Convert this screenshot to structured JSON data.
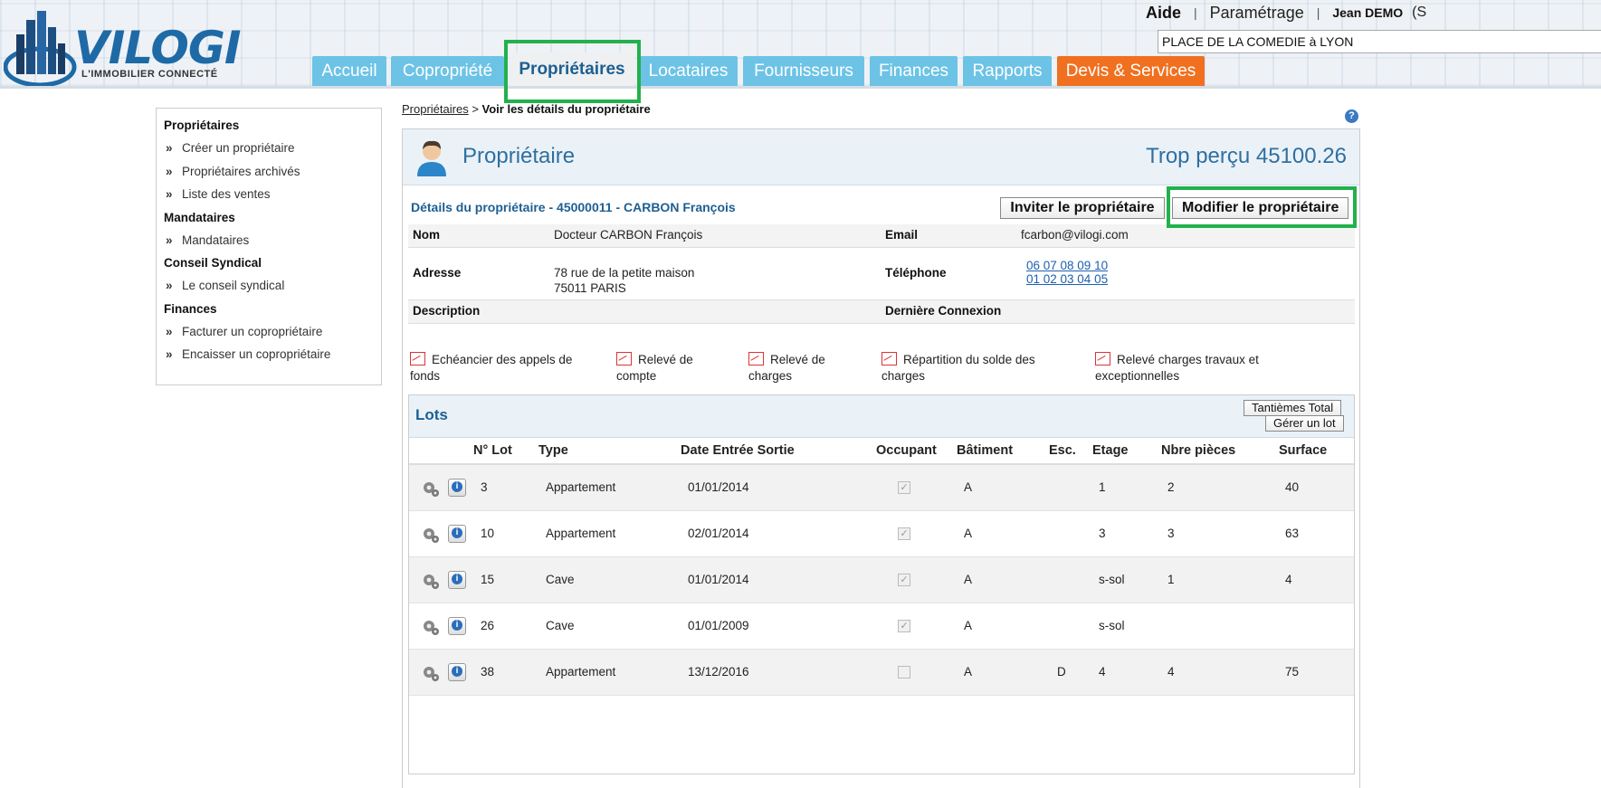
{
  "app": {
    "brand": "VILOGI",
    "tagline": "L'IMMOBILIER CONNECTÉ",
    "accent": "#1e6aa6",
    "tab_color": "#6cc3e6",
    "tab_orange": "#f07020"
  },
  "top": {
    "help": "Aide",
    "separator": "|",
    "settings": "Paramétrage",
    "user": "Jean DEMO",
    "user_extra": "(S",
    "search_value": "PLACE DE LA COMEDIE à LYON"
  },
  "nav": {
    "tabs": [
      {
        "label": "Accueil"
      },
      {
        "label": "Copropriété"
      },
      {
        "label": "Propriétaires",
        "active": true
      },
      {
        "label": "Locataires"
      },
      {
        "label": "Fournisseurs"
      },
      {
        "label": "Finances"
      },
      {
        "label": "Rapports"
      },
      {
        "label": "Devis & Services"
      }
    ]
  },
  "sidebar": {
    "sections": [
      {
        "title": "Propriétaires",
        "items": [
          "Créer un propriétaire",
          "Propriétaires archivés",
          "Liste des ventes"
        ]
      },
      {
        "title": "Mandataires",
        "items": [
          "Mandataires"
        ]
      },
      {
        "title": "Conseil Syndical",
        "items": [
          "Le conseil syndical"
        ]
      },
      {
        "title": "Finances",
        "items": [
          "Facturer un copropriétaire",
          "Encaisser un copropriétaire"
        ]
      }
    ]
  },
  "breadcrumb": {
    "link": "Propriétaires",
    "sep": " > ",
    "current": "Voir les détails du propriétaire"
  },
  "panel": {
    "title": "Propriétaire",
    "trop_percu": "Trop perçu 45100.26",
    "details_title": "Détails du propriétaire - 45000011 - CARBON François",
    "invite_button": "Inviter le propriétaire",
    "edit_button": "Modifier le propriétaire",
    "fields": {
      "nom_label": "Nom",
      "nom_value": "Docteur CARBON François",
      "email_label": "Email",
      "email_value": "fcarbon@vilogi.com",
      "adresse_label": "Adresse",
      "adresse_line1": "78 rue de la petite maison",
      "adresse_line2": "75011 PARIS",
      "tel_label": "Téléphone",
      "tel_1": "06 07 08 09 10",
      "tel_2": "01 02 03 04 05",
      "description_label": "Description",
      "connexion_label": "Dernière Connexion"
    },
    "documents": [
      {
        "line1": "Echéancier des appels de",
        "line2": "fonds"
      },
      {
        "line1": "Relevé de",
        "line2": "compte"
      },
      {
        "line1": "Relevé de",
        "line2": "charges"
      },
      {
        "line1": "Répartition du solde des",
        "line2": "charges"
      },
      {
        "line1": "Relevé charges travaux et",
        "line2": "exceptionnelles"
      }
    ]
  },
  "lots": {
    "title": "Lots",
    "tantiemes_button": "Tantièmes Total",
    "manage_button": "Gérer un lot",
    "columns": [
      "N° Lot",
      "Type",
      "Date Entrée Sortie",
      "Occupant",
      "Bâtiment",
      "Esc.",
      "Etage",
      "Nbre pièces",
      "Surface"
    ],
    "rows": [
      {
        "lot": "3",
        "type": "Appartement",
        "date": "01/01/2014",
        "occupant": true,
        "batiment": "A",
        "esc": "",
        "etage": "1",
        "pieces": "2",
        "surface": "40"
      },
      {
        "lot": "10",
        "type": "Appartement",
        "date": "02/01/2014",
        "occupant": true,
        "batiment": "A",
        "esc": "",
        "etage": "3",
        "pieces": "3",
        "surface": "63"
      },
      {
        "lot": "15",
        "type": "Cave",
        "date": "01/01/2014",
        "occupant": true,
        "batiment": "A",
        "esc": "",
        "etage": "s-sol",
        "pieces": "1",
        "surface": "4"
      },
      {
        "lot": "26",
        "type": "Cave",
        "date": "01/01/2009",
        "occupant": true,
        "batiment": "A",
        "esc": "",
        "etage": "s-sol",
        "pieces": "",
        "surface": ""
      },
      {
        "lot": "38",
        "type": "Appartement",
        "date": "13/12/2016",
        "occupant": false,
        "batiment": "A",
        "esc": "D",
        "etage": "4",
        "pieces": "4",
        "surface": "75"
      }
    ]
  }
}
